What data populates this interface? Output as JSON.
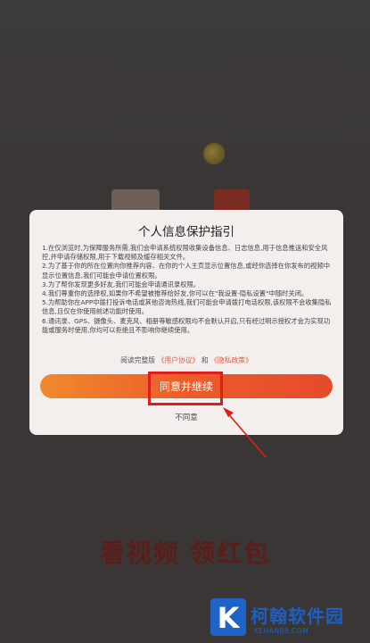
{
  "background": {
    "slogan": "看视频 领红包"
  },
  "dialog": {
    "title": "个人信息保护指引",
    "paragraphs": [
      "1.在仅浏览时,为保障服务所需,我们会申请系统权限收集设备信息、日志信息,用于信息推送和安全风控,并申请存储权限,用于下载视频及缓存相关文件。",
      "2.为了基于你的所在位置向你推荐内容、在你的个人主页显示位置信息,或经你选择在你发布的视频中显示位置信息,我们可能会申请位置权限。",
      "3.为了帮你发现更多好友,我们可能会申请通讯录权限。",
      "4.我们尊重你的选择权,如果你不希望被推荐给好友,你可以在\"我设置-隐私设置\"中随时关闭。",
      "5.为帮助你在APP中拨打投诉电话或其他咨询热线,我们可能会申请拨打电话权限,该权限不会收集隐私信息,且仅在你使用前述功能时使用。",
      "6.通讯录、GPS、摄像头、麦克风、相册等敏感权限均不会默认开启,只有经过明示授权才会为实现功能或服务时使用,你均可以拒绝且不影响你继续使用。"
    ],
    "consent_prefix": "阅读完整版",
    "user_agreement_link": "《用户协议》",
    "consent_and": "和",
    "privacy_policy_link": "《隐私政策》",
    "agree_button": "同意并继续",
    "disagree_button": "不同意"
  },
  "watermark": {
    "name": "柯翰软件园",
    "domain": "KEHAN88.COM",
    "logo_letter": "K"
  },
  "colors": {
    "accent": "#ec5c2a",
    "highlight": "#e01c1c",
    "watermark": "#1e5fc0"
  }
}
